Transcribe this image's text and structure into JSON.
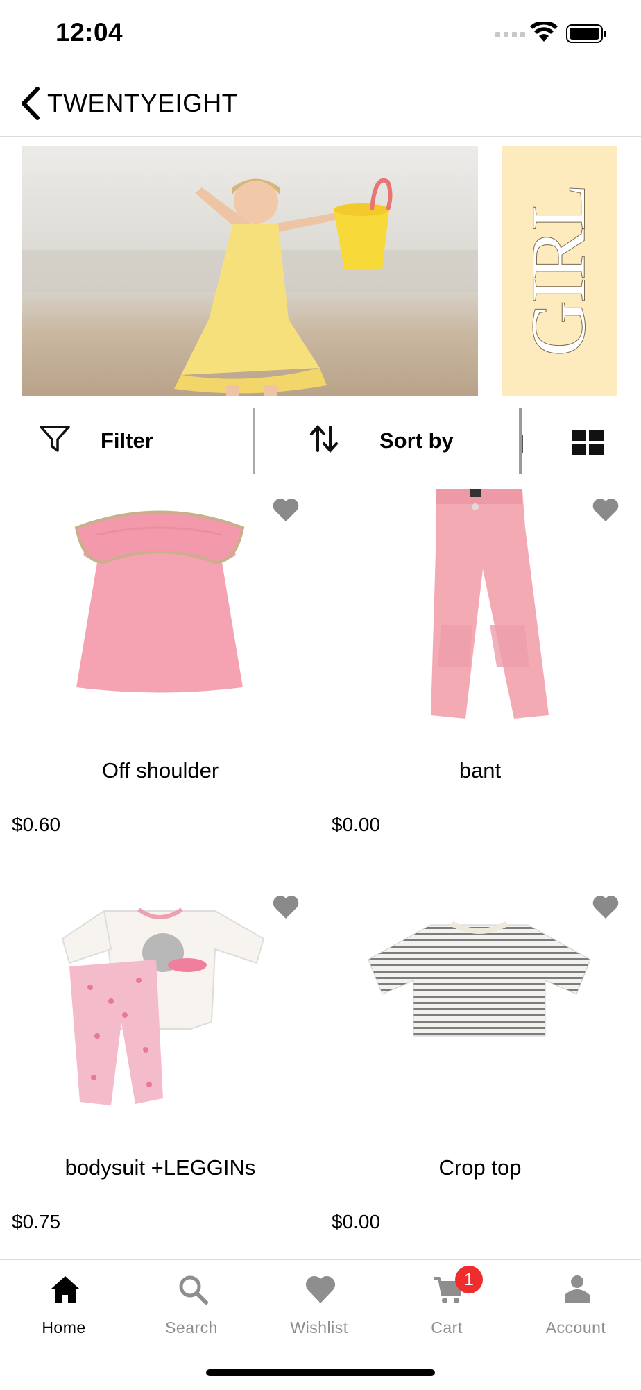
{
  "status_bar": {
    "time": "12:04"
  },
  "header": {
    "title": "TWENTYEIGHT"
  },
  "banner": {
    "tag_text": "GIRL",
    "tag_color": "#fdebbd"
  },
  "toolbar": {
    "filter_label": "Filter",
    "sort_label": "Sort by"
  },
  "products": [
    {
      "name": "Off shoulder",
      "price": "$0.60",
      "image": "pink-ruffle-top"
    },
    {
      "name": "bant",
      "price": "$0.00",
      "image": "pink-pants"
    },
    {
      "name": "bodysuit +LEGGINs",
      "price": "$0.75",
      "image": "bodysuit-leggings-set"
    },
    {
      "name": "Crop top",
      "price": "$0.00",
      "image": "striped-crop-top"
    }
  ],
  "tab_bar": {
    "items": [
      {
        "label": "Home",
        "icon": "home-icon",
        "active": true
      },
      {
        "label": "Search",
        "icon": "search-icon",
        "active": false
      },
      {
        "label": "Wishlist",
        "icon": "heart-icon",
        "active": false
      },
      {
        "label": "Cart",
        "icon": "cart-icon",
        "active": false
      },
      {
        "label": "Account",
        "icon": "account-icon",
        "active": false
      }
    ],
    "cart_badge": "1"
  },
  "colors": {
    "accent": "#000000",
    "badge": "#ef2d2d",
    "inactive": "#8e8e8e",
    "heart": "#8a8a8a"
  }
}
